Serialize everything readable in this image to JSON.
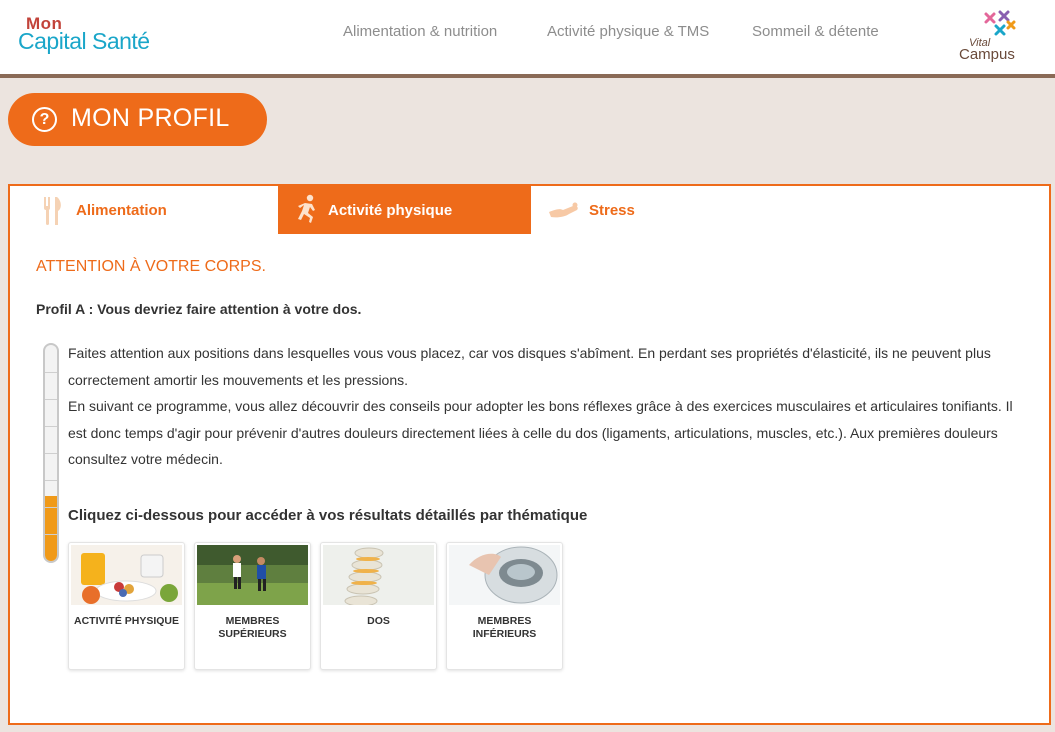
{
  "header": {
    "logo_mon": "Mon",
    "logo_capital": "Capital Santé",
    "nav": [
      "Alimentation & nutrition",
      "Activité physique & TMS",
      "Sommeil & détente"
    ],
    "partner_line1": "Vital",
    "partner_line2": "Campus"
  },
  "profil": {
    "icon": "?",
    "title": "MON PROFIL"
  },
  "tabs": [
    {
      "label": "Alimentation",
      "icon": "fork-knife-icon",
      "active": false
    },
    {
      "label": "Activité physique",
      "icon": "runner-icon",
      "active": true
    },
    {
      "label": "Stress",
      "icon": "stress-icon",
      "active": false
    }
  ],
  "content": {
    "section_title": "ATTENTION À VOTRE CORPS.",
    "profile_line": "Profil A : Vous devriez faire attention à votre dos.",
    "paragraph1": "Faites attention aux positions dans lesquelles vous vous placez, car vos disques s'abîment. En perdant ses propriétés d'élasticité, ils ne peuvent plus correctement amortir les mouvements et les pressions.",
    "paragraph2": "En suivant ce programme, vous allez découvrir des conseils pour adopter les bons réflexes grâce à  des exercices musculaires et articulaires tonifiants. Il est donc temps d'agir pour prévenir d'autres douleurs directement liées à  celle du dos (ligaments, articulations, muscles, etc.). Aux premières douleurs consultez votre médecin.",
    "gauge_level": 0.3,
    "cta": "Cliquez ci-dessous pour accéder à vos résultats détaillés par thématique"
  },
  "cards": [
    {
      "line1": "ACTIVITÉ PHYSIQUE",
      "line2": ""
    },
    {
      "line1": "MEMBRES",
      "line2": "SUPÉRIEURS"
    },
    {
      "line1": "DOS",
      "line2": ""
    },
    {
      "line1": "MEMBRES",
      "line2": "INFÉRIEURS"
    }
  ],
  "colors": {
    "accent": "#ee6b1a",
    "brand_blue": "#1aa6c9",
    "gauge": "#f09a19"
  }
}
